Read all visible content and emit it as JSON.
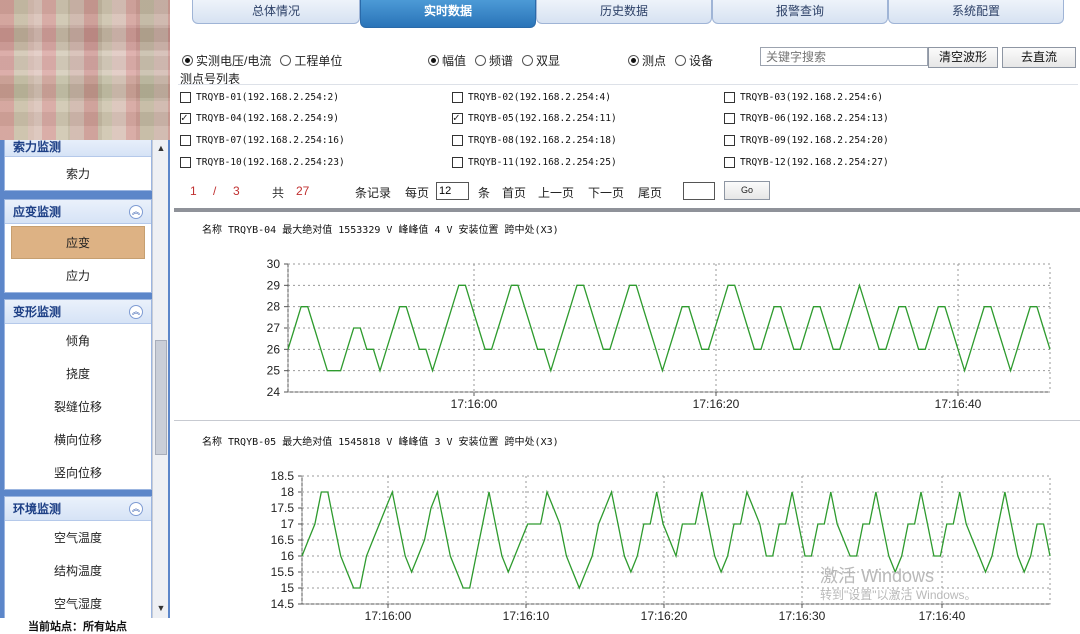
{
  "sidebar": {
    "groups": [
      {
        "title": "索力监测",
        "items": [
          {
            "label": "索力",
            "active": false
          }
        ]
      },
      {
        "title": "应变监测",
        "items": [
          {
            "label": "应变",
            "active": true
          },
          {
            "label": "应力",
            "active": false
          }
        ]
      },
      {
        "title": "变形监测",
        "items": [
          {
            "label": "倾角"
          },
          {
            "label": "挠度"
          },
          {
            "label": "裂缝位移"
          },
          {
            "label": "横向位移"
          },
          {
            "label": "竖向位移"
          }
        ]
      },
      {
        "title": "环境监测",
        "items": [
          {
            "label": "空气温度"
          },
          {
            "label": "结构温度"
          },
          {
            "label": "空气湿度"
          }
        ]
      }
    ],
    "current_site": "当前站点：所有站点"
  },
  "tabs": [
    {
      "label": "总体情况",
      "active": false
    },
    {
      "label": "实时数据",
      "active": true
    },
    {
      "label": "历史数据",
      "active": false
    },
    {
      "label": "报警查询",
      "active": false
    },
    {
      "label": "系统配置",
      "active": false
    }
  ],
  "options": {
    "mode": [
      {
        "label": "实测电压/电流",
        "checked": true
      },
      {
        "label": "工程单位",
        "checked": false
      }
    ],
    "display": [
      {
        "label": "幅值",
        "checked": true
      },
      {
        "label": "频谱",
        "checked": false
      },
      {
        "label": "双显",
        "checked": false
      }
    ],
    "target": [
      {
        "label": "测点",
        "checked": true
      },
      {
        "label": "设备",
        "checked": false
      }
    ]
  },
  "search": {
    "placeholder": "关键字搜索"
  },
  "buttons": {
    "clear_wave": "清空波形",
    "remove_dc": "去直流",
    "go": "Go"
  },
  "points": {
    "header": "测点号列表",
    "items": [
      {
        "label": "TRQYB-01(192.168.2.254:2)",
        "checked": false
      },
      {
        "label": "TRQYB-02(192.168.2.254:4)",
        "checked": false
      },
      {
        "label": "TRQYB-03(192.168.2.254:6)",
        "checked": false
      },
      {
        "label": "TRQYB-04(192.168.2.254:9)",
        "checked": true
      },
      {
        "label": "TRQYB-05(192.168.2.254:11)",
        "checked": true
      },
      {
        "label": "TRQYB-06(192.168.2.254:13)",
        "checked": false
      },
      {
        "label": "TRQYB-07(192.168.2.254:16)",
        "checked": false
      },
      {
        "label": "TRQYB-08(192.168.2.254:18)",
        "checked": false
      },
      {
        "label": "TRQYB-09(192.168.2.254:20)",
        "checked": false
      },
      {
        "label": "TRQYB-10(192.168.2.254:23)",
        "checked": false
      },
      {
        "label": "TRQYB-11(192.168.2.254:25)",
        "checked": false
      },
      {
        "label": "TRQYB-12(192.168.2.254:27)",
        "checked": false
      }
    ]
  },
  "pager": {
    "current": "1",
    "slash": "/",
    "total_pages": "3",
    "total_label": "共",
    "total_records": "27",
    "records_label": "条记录",
    "per_page_label": "每页",
    "per_page_value": "12",
    "per_page_unit": "条",
    "first": "首页",
    "prev": "上一页",
    "next": "下一页",
    "last": "尾页"
  },
  "chart_data": [
    {
      "type": "line",
      "title": "名称 TRQYB-04 最大绝对值 1553329 V 峰峰值 4 V 安装位置 跨中处(X3)",
      "ylim": [
        24,
        30
      ],
      "yticks": [
        "24",
        "25",
        "26",
        "27",
        "28",
        "29",
        "30"
      ],
      "xticks": [
        "17:16:00",
        "17:16:20",
        "17:16:40"
      ],
      "grid": true,
      "color": "#2e9b2e",
      "values": [
        26,
        27,
        28,
        28,
        27,
        26,
        25,
        25,
        25,
        26,
        27,
        27,
        26,
        26,
        25,
        26,
        27,
        28,
        28,
        27,
        26,
        26,
        25,
        26,
        27,
        28,
        29,
        29,
        28,
        27,
        26,
        26,
        27,
        28,
        29,
        29,
        28,
        27,
        26,
        26,
        25,
        26,
        27,
        28,
        29,
        29,
        28,
        27,
        26,
        26,
        27,
        28,
        29,
        29,
        28,
        27,
        26,
        25,
        26,
        27,
        28,
        28,
        27,
        26,
        26,
        27,
        28,
        29,
        29,
        28,
        27,
        26,
        26,
        27,
        28,
        28,
        27,
        26,
        26,
        27,
        28,
        28,
        27,
        26,
        26,
        27,
        28,
        29,
        28,
        27,
        26,
        26,
        27,
        28,
        28,
        27,
        26,
        26,
        27,
        28,
        28,
        27,
        26,
        25,
        26,
        27,
        28,
        28,
        27,
        26,
        25,
        26,
        27,
        28,
        28,
        27,
        26
      ]
    },
    {
      "type": "line",
      "title": "名称 TRQYB-05 最大绝对值 1545818 V 峰峰值 3 V 安装位置 跨中处(X3)",
      "ylim": [
        14.5,
        18.5
      ],
      "yticks": [
        "14.5",
        "15",
        "15.5",
        "16",
        "16.5",
        "17",
        "17.5",
        "18",
        "18.5"
      ],
      "xticks": [
        "17:16:00",
        "17:16:10",
        "17:16:20",
        "17:16:30",
        "17:16:40"
      ],
      "grid": true,
      "color": "#2e9b2e",
      "values": [
        16,
        16.5,
        17,
        18,
        18,
        17,
        16,
        15.5,
        15,
        15,
        16,
        16.5,
        17,
        17.5,
        18,
        17,
        16,
        15.5,
        16,
        16.5,
        17.5,
        18,
        17,
        16,
        15.5,
        15,
        15,
        16,
        17,
        18,
        17,
        16,
        15.5,
        16,
        16.5,
        17,
        17,
        17,
        18,
        17.5,
        17,
        16,
        15.5,
        15,
        15.5,
        16,
        17,
        17.5,
        18,
        17,
        16,
        15.5,
        16,
        17,
        17,
        18,
        17,
        16.5,
        16,
        17,
        17,
        17,
        18,
        17,
        16,
        15.5,
        16,
        17,
        17,
        18,
        17.5,
        17,
        16,
        16,
        17,
        17,
        18,
        17,
        16,
        16,
        17,
        17,
        18,
        17,
        16.5,
        16,
        16,
        17,
        17,
        18,
        17,
        16,
        15.5,
        16,
        17,
        17,
        18,
        17,
        16,
        16,
        17,
        17,
        18,
        17,
        16.5,
        16,
        15.5,
        16,
        17,
        18,
        17,
        16,
        15.5,
        16,
        17,
        17,
        16
      ]
    }
  ],
  "watermark": {
    "line1": "激活 Windows",
    "line2": "转到\"设置\"以激活 Windows。"
  }
}
